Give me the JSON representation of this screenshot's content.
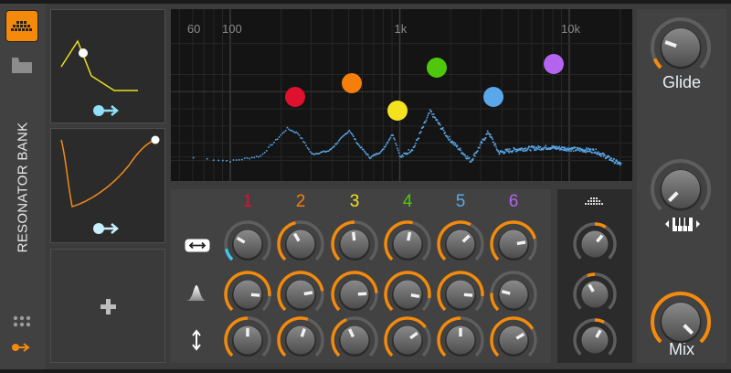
{
  "device": {
    "title": "RESONATOR BANK"
  },
  "colors": {
    "accent": "#f58a0a",
    "mod": "#6fd6f5",
    "res": [
      "#e0102f",
      "#f57f0a",
      "#f5e21f",
      "#4fc70a",
      "#5aa7ea",
      "#b365f0"
    ]
  },
  "spectrum": {
    "freq_labels": [
      {
        "text": "60",
        "hz": 60
      },
      {
        "text": "100",
        "hz": 100
      },
      {
        "text": "1k",
        "hz": 1000
      },
      {
        "text": "10k",
        "hz": 10000
      }
    ],
    "freq_range": [
      40,
      22000
    ],
    "resonators": [
      {
        "label": "1",
        "hz": 242,
        "level": 0.49
      },
      {
        "label": "2",
        "hz": 521,
        "level": 0.57
      },
      {
        "label": "3",
        "hz": 970,
        "level": 0.41
      },
      {
        "label": "4",
        "hz": 1650,
        "level": 0.66
      },
      {
        "label": "5",
        "hz": 3550,
        "level": 0.49
      },
      {
        "label": "6",
        "hz": 8100,
        "level": 0.68
      }
    ],
    "curve": [
      [
        60,
        0.14
      ],
      [
        100,
        0.12
      ],
      [
        150,
        0.15
      ],
      [
        215,
        0.31
      ],
      [
        250,
        0.28
      ],
      [
        300,
        0.16
      ],
      [
        380,
        0.18
      ],
      [
        500,
        0.3
      ],
      [
        560,
        0.22
      ],
      [
        660,
        0.14
      ],
      [
        780,
        0.18
      ],
      [
        900,
        0.28
      ],
      [
        1000,
        0.14
      ],
      [
        1200,
        0.2
      ],
      [
        1500,
        0.41
      ],
      [
        1900,
        0.26
      ],
      [
        2600,
        0.12
      ],
      [
        3300,
        0.29
      ],
      [
        3800,
        0.17
      ],
      [
        5000,
        0.19
      ],
      [
        7500,
        0.2
      ],
      [
        14000,
        0.18
      ],
      [
        20000,
        0.1
      ]
    ]
  },
  "resonator_columns": [
    "1",
    "2",
    "3",
    "4",
    "5",
    "6"
  ],
  "knob_rows": [
    {
      "name": "pitch",
      "icon": "pitch-range-icon",
      "knobs": [
        {
          "value": 0.28,
          "arc": [
            0,
            0.12
          ],
          "color": "#3ec8ee"
        },
        {
          "value": 0.39,
          "arc": [
            0,
            0.45
          ]
        },
        {
          "value": 0.48,
          "arc": [
            0,
            0.5
          ]
        },
        {
          "value": 0.54,
          "arc": [
            0,
            0.55
          ]
        },
        {
          "value": 0.67,
          "arc": [
            0,
            0.6
          ]
        },
        {
          "value": 0.8,
          "arc": [
            0,
            0.78
          ]
        }
      ]
    },
    {
      "name": "decay",
      "icon": "resonance-peak-icon",
      "knobs": [
        {
          "value": 0.85,
          "arc": [
            0,
            0.85
          ]
        },
        {
          "value": 0.8,
          "arc": [
            0,
            0.8
          ]
        },
        {
          "value": 0.82,
          "arc": [
            0,
            0.82
          ]
        },
        {
          "value": 0.87,
          "arc": [
            0,
            0.87
          ]
        },
        {
          "value": 0.85,
          "arc": [
            0,
            0.85
          ]
        },
        {
          "value": 0.22,
          "arc": [
            0,
            0.18
          ]
        }
      ]
    },
    {
      "name": "gain",
      "icon": "gain-arrows-icon",
      "knobs": [
        {
          "value": 0.5,
          "arc": [
            0,
            0.5
          ]
        },
        {
          "value": 0.57,
          "arc": [
            0,
            0.57
          ]
        },
        {
          "value": 0.41,
          "arc": [
            0,
            0.42
          ]
        },
        {
          "value": 0.7,
          "arc": [
            0,
            0.7
          ]
        },
        {
          "value": 0.5,
          "arc": [
            0,
            0.5
          ]
        },
        {
          "value": 0.72,
          "arc": [
            0,
            0.72
          ]
        }
      ]
    }
  ],
  "global_knobs": [
    {
      "value": 0.65,
      "arc": [
        0.5,
        0.62
      ]
    },
    {
      "value": 0.39,
      "arc": [
        0.42,
        0.5
      ]
    },
    {
      "value": 0.61,
      "arc": [
        0.5,
        0.6
      ]
    }
  ],
  "right": {
    "glide": {
      "label": "Glide",
      "value": 0.24,
      "arc": [
        0,
        0.08
      ]
    },
    "keytrack": {
      "value": 0.0,
      "arc": [
        0,
        0
      ]
    },
    "mix": {
      "label": "Mix",
      "value": 1.0,
      "arc": [
        0,
        1
      ]
    }
  }
}
